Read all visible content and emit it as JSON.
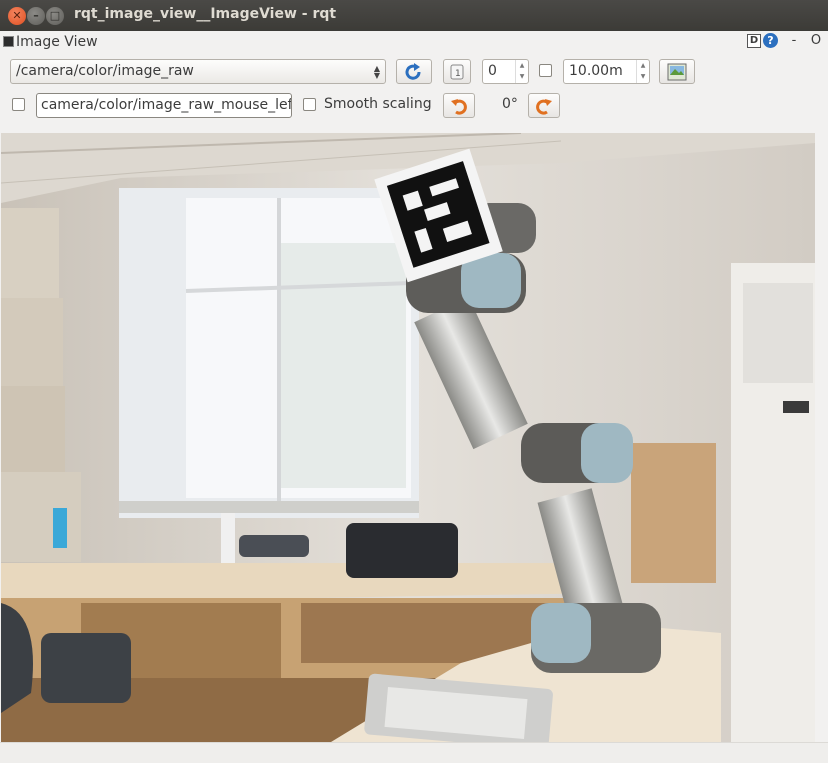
{
  "window": {
    "title": "rqt_image_view__ImageView - rqt"
  },
  "plugin": {
    "title": "Image View",
    "d_label": "D",
    "help_label": "?",
    "minimize_label": "-",
    "close_label": "O"
  },
  "toolbar": {
    "topic": "/camera/color/image_raw",
    "refresh_icon": "refresh-icon",
    "zoom_value": "0",
    "max_range": "10.00m",
    "save_icon": "save-image-icon"
  },
  "row2": {
    "mouse_topic": "camera/color/image_raw_mouse_left",
    "smooth_scaling_label": "Smooth scaling",
    "rotation_value": "0°"
  },
  "image": {
    "description_icon": "camera-image"
  },
  "colors": {
    "titlebar": "#3c3b37",
    "close_button": "#e05021",
    "accent_blue": "#2b6fbf",
    "rotate_orange": "#e07020"
  }
}
